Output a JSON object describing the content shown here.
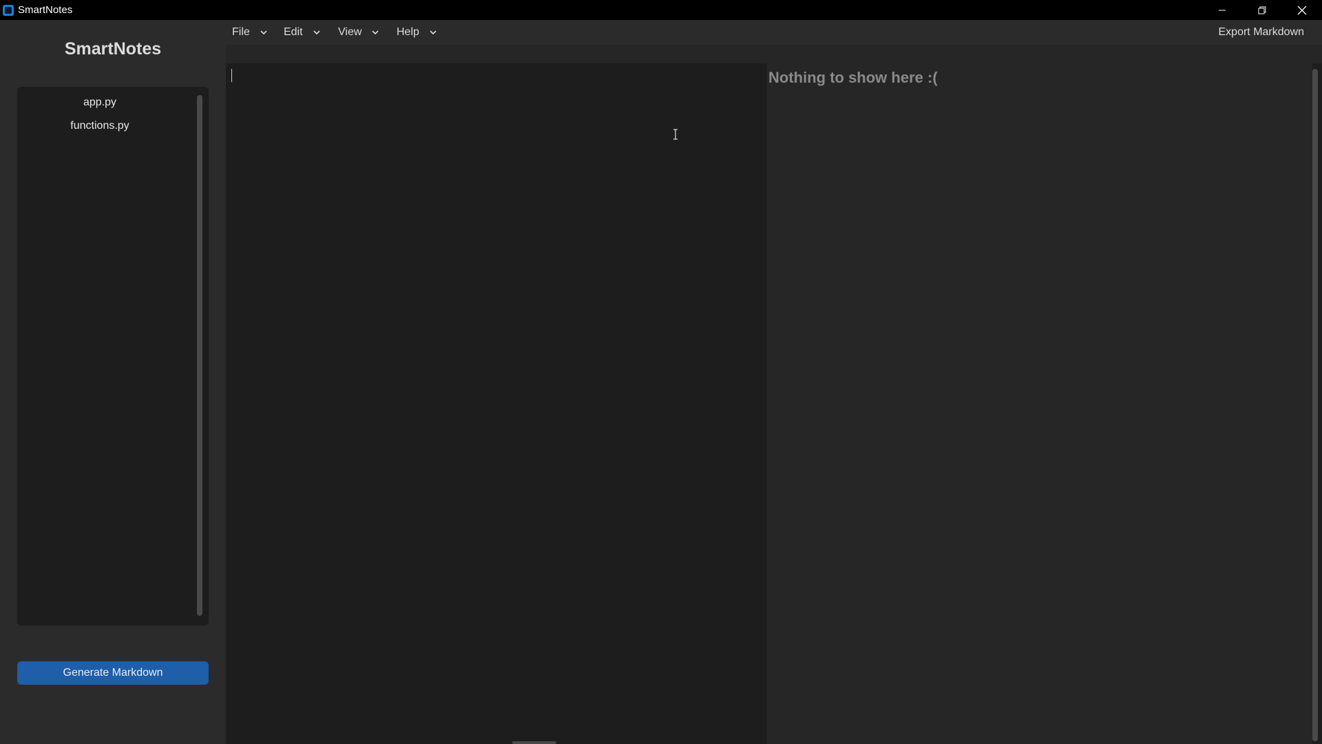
{
  "window": {
    "title": "SmartNotes"
  },
  "sidebar": {
    "title": "SmartNotes",
    "files": [
      "app.py",
      "functions.py"
    ],
    "generate_button": "Generate Markdown"
  },
  "menubar": {
    "menus": [
      {
        "label": "File"
      },
      {
        "label": "Edit"
      },
      {
        "label": "View"
      },
      {
        "label": "Help"
      }
    ],
    "export_button": "Export Markdown"
  },
  "preview": {
    "empty_message": "Nothing to show here :("
  },
  "icons": {
    "app": "app-logo-icon",
    "minimize": "minimize-icon",
    "maximize": "restore-icon",
    "close": "close-icon",
    "menu_chevron": "chevron-down-icon"
  },
  "colors": {
    "accent": "#1f5ea8",
    "titlebar": "#000000",
    "panel": "#2b2b2b",
    "editor": "#1d1d1d"
  }
}
